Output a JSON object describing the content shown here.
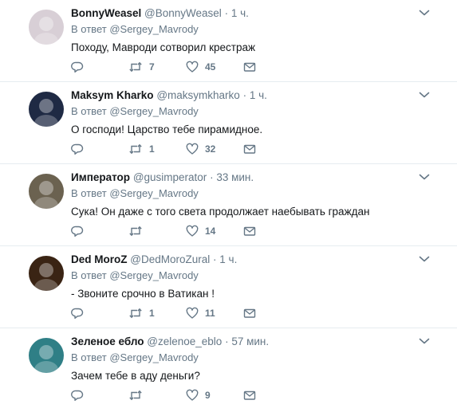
{
  "tweets": [
    {
      "name": "BonnyWeasel",
      "handle": "@BonnyWeasel",
      "time": "1 ч.",
      "reply_prefix": "В ответ",
      "reply_to": "@Sergey_Mavrody",
      "text": "Походу, Мавроди сотворил крестраж",
      "retweets": "7",
      "likes": "45",
      "avatar_color": "#d8cfd6"
    },
    {
      "name": "Maksym Kharko",
      "handle": "@maksymkharko",
      "time": "1 ч.",
      "reply_prefix": "В ответ",
      "reply_to": "@Sergey_Mavrody",
      "text": "О господи! Царство тебе пирамидное.",
      "retweets": "1",
      "likes": "32",
      "avatar_color": "#1f2a44"
    },
    {
      "name": "Император",
      "handle": "@gusimperator",
      "time": "33 мин.",
      "reply_prefix": "В ответ",
      "reply_to": "@Sergey_Mavrody",
      "text": "Сука! Он даже с того света продолжает наебывать граждан",
      "retweets": "",
      "likes": "14",
      "avatar_color": "#6b6250"
    },
    {
      "name": "Ded MoroZ",
      "handle": "@DedMoroZural",
      "time": "1 ч.",
      "reply_prefix": "В ответ",
      "reply_to": "@Sergey_Mavrody",
      "text": "- Звоните срочно в Ватикан !",
      "retweets": "1",
      "likes": "11",
      "avatar_color": "#3a2414"
    },
    {
      "name": "Зеленое ебло",
      "handle": "@zelenoe_eblo",
      "time": "57 мин.",
      "reply_prefix": "В ответ",
      "reply_to": "@Sergey_Mavrody",
      "text": "Зачем тебе в аду деньги?",
      "retweets": "",
      "likes": "9",
      "avatar_color": "#2f7f86"
    }
  ],
  "separator": "·",
  "icons": {
    "reply": "reply-icon",
    "retweet": "retweet-icon",
    "like": "heart-icon",
    "dm": "envelope-icon",
    "more": "chevron-down-icon"
  },
  "colors": {
    "text": "#14171a",
    "muted": "#657786",
    "border": "#e6ecf0"
  }
}
